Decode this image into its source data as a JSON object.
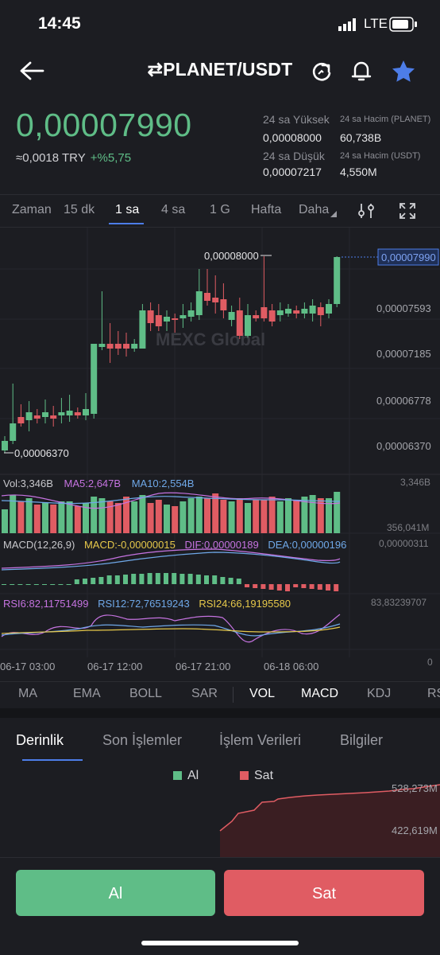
{
  "status_bar": {
    "time": "14:45",
    "network": "LTE"
  },
  "header": {
    "pair": "⇄PLANET/USDT"
  },
  "ticker": {
    "price": "0,00007990",
    "fiat": "≈0,0018 TRY",
    "change": "+%5,75",
    "high_label": "24 sa Yüksek",
    "high_value": "0,00008000",
    "low_label": "24 sa Düşük",
    "low_value": "0,00007217",
    "vol_base_label": "24 sa Hacim (PLANET)",
    "vol_base_value": "60,738B",
    "vol_quote_label": "24 sa Hacim  (USDT)",
    "vol_quote_value": "4,550M"
  },
  "timeframes": [
    "Zaman",
    "15 dk",
    "1 sa",
    "4 sa",
    "1 G",
    "Hafta",
    "Daha"
  ],
  "chart": {
    "y_ticks": [
      "0,00007593",
      "0,00007185",
      "0,00006778",
      "0,00006370"
    ],
    "current_price_tag": "0,00007990",
    "high_marker": "0,00008000",
    "low_marker": "0,00006370",
    "watermark": "MEXC Global",
    "vol_legend": {
      "vol": "Vol:3,346B",
      "ma5": "MA5:2,647B",
      "ma10": "MA10:2,554B"
    },
    "vol_axis": {
      "top": "3,346B",
      "bottom": "356,041M"
    },
    "macd_legend": {
      "name": "MACD(12,26,9)",
      "macd": "MACD:-0,00000015",
      "dif": "DIF:0,00000189",
      "dea": "DEA:0,00000196"
    },
    "macd_axis": "0,00000311",
    "rsi_legend": {
      "rsi6": "RSI6:82,11751499",
      "rsi12": "RSI12:72,76519243",
      "rsi24": "RSI24:66,19195580"
    },
    "rsi_axis": {
      "top": "83,83239707",
      "bottom": "0"
    },
    "x_labels": [
      "06-17 03:00",
      "06-17 12:00",
      "06-17 21:00",
      "06-18 06:00"
    ]
  },
  "indicators": [
    "MA",
    "EMA",
    "BOLL",
    "SAR",
    "VOL",
    "MACD",
    "KDJ",
    "RS"
  ],
  "tabs": [
    "Derinlik",
    "Son İşlemler",
    "İşlem Verileri",
    "Bilgiler"
  ],
  "depth": {
    "buy_label": "Al",
    "sell_label": "Sat",
    "axis_top": "528,273M",
    "axis_mid": "422,619M"
  },
  "actions": {
    "buy": "Al",
    "sell": "Sat"
  },
  "colors": {
    "up": "#5fbd87",
    "down": "#e05c63",
    "accent": "#4d7de8"
  }
}
